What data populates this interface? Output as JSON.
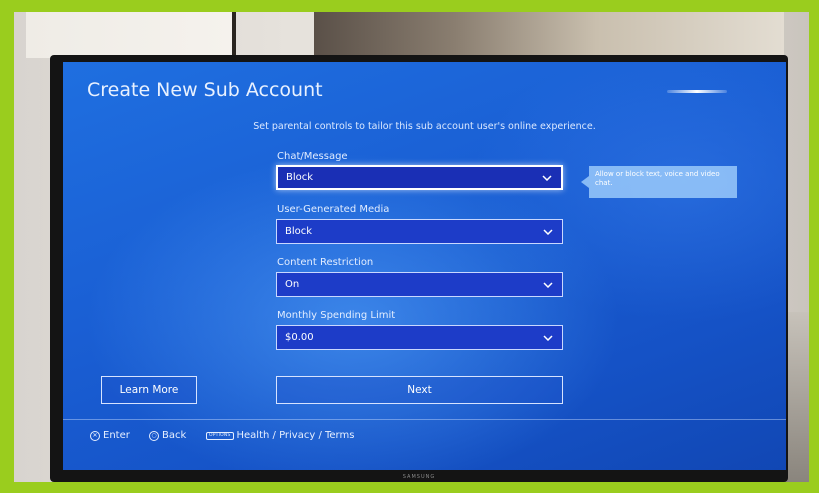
{
  "screen": {
    "title": "Create New Sub Account",
    "subtitle": "Set parental controls to tailor this sub account user's online experience."
  },
  "fields": [
    {
      "label": "Chat/Message",
      "value": "Block"
    },
    {
      "label": "User-Generated Media",
      "value": "Block"
    },
    {
      "label": "Content Restriction",
      "value": "On"
    },
    {
      "label": "Monthly Spending Limit",
      "value": "$0.00"
    }
  ],
  "tooltip": {
    "text": "Allow or block text, voice and video chat."
  },
  "buttons": {
    "learn_more": "Learn More",
    "next": "Next"
  },
  "footer": {
    "enter_label": "Enter",
    "back_label": "Back",
    "options_chip": "OPTIONS",
    "options_label": "Health / Privacy / Terms"
  },
  "tv": {
    "brand": "SAMSUNG"
  },
  "icons": {
    "dropdown": "chevron-down-icon",
    "enter": "cross-button-icon",
    "back": "circle-button-icon"
  },
  "colors": {
    "screen_bg": "#1a5fd4",
    "dropdown_bg": "#1d3cc8",
    "border_accent": "#9acd1e"
  }
}
